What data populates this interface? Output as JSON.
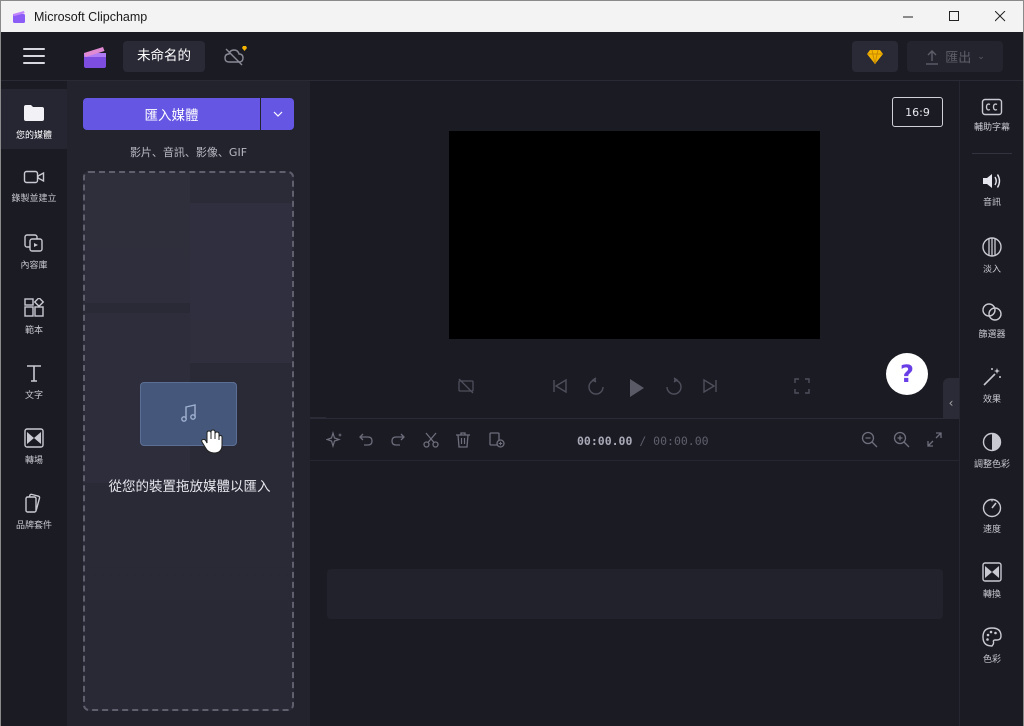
{
  "window": {
    "title": "Microsoft Clipchamp",
    "minimize": "—",
    "maximize": "☐",
    "close": "✕"
  },
  "header": {
    "project_name": "未命名的",
    "export_label": "匯出"
  },
  "left_rail": {
    "items": [
      {
        "label": "您的媒體",
        "icon": "folder-icon"
      },
      {
        "label": "錄製並建立",
        "icon": "camera-icon"
      },
      {
        "label": "內容庫",
        "icon": "library-icon"
      },
      {
        "label": "範本",
        "icon": "templates-icon"
      },
      {
        "label": "文字",
        "icon": "text-icon"
      },
      {
        "label": "轉場",
        "icon": "transition-icon"
      },
      {
        "label": "品牌套件",
        "icon": "brand-kit-icon"
      }
    ]
  },
  "media": {
    "import_label": "匯入媒體",
    "formats": "影片、音訊、影像、GIF",
    "drop_text": "從您的裝置拖放媒體以匯入"
  },
  "preview": {
    "aspect_ratio": "16:9",
    "help": "?"
  },
  "timeline": {
    "current_time": "00:00.00",
    "separator": " / ",
    "total_time": "00:00.00"
  },
  "right_rail": {
    "items": [
      {
        "label": "輔助字幕",
        "icon": "captions-icon"
      },
      {
        "label": "音訊",
        "icon": "audio-icon"
      },
      {
        "label": "淡入",
        "icon": "fade-icon"
      },
      {
        "label": "篩選器",
        "icon": "filters-icon"
      },
      {
        "label": "效果",
        "icon": "effects-icon"
      },
      {
        "label": "調整色彩",
        "icon": "adjust-colors-icon"
      },
      {
        "label": "速度",
        "icon": "speed-icon"
      },
      {
        "label": "轉換",
        "icon": "transition-icon"
      },
      {
        "label": "色彩",
        "icon": "color-icon"
      }
    ]
  },
  "colors": {
    "accent": "#6656e4",
    "background": "#1b1b24",
    "panel": "#23232e",
    "premium": "#f4b400"
  }
}
